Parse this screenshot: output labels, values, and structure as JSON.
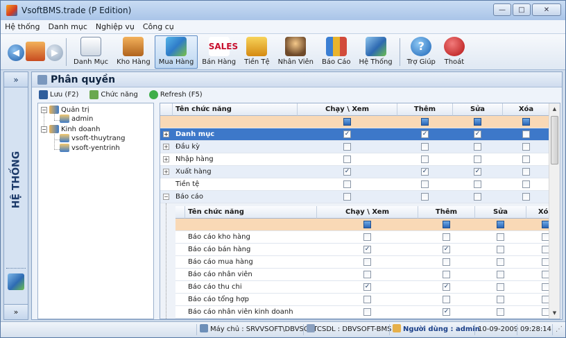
{
  "window": {
    "title": "VsoftBMS.trade (P Edition)",
    "btn_min": "—",
    "btn_max": "□",
    "btn_close": "✕"
  },
  "menu": [
    "Hệ thống",
    "Danh mục",
    "Nghiệp vụ",
    "Công cụ"
  ],
  "toolbar": {
    "back": "◀",
    "forward": "▶",
    "buttons": [
      "Danh Mục",
      "Kho Hàng",
      "Mua Hàng",
      "Bán Hàng",
      "Tiền Tệ",
      "Nhân Viên",
      "Báo Cáo",
      "Hệ Thống",
      "Trợ Giúp",
      "Thoát"
    ],
    "active": "Mua Hàng"
  },
  "leftstrip": {
    "collapse": "»",
    "label": "HỆ THỐNG",
    "expand": "»"
  },
  "panel": {
    "title": "Phân quyền",
    "save": "Lưu (F2)",
    "functions": "Chức năng",
    "refresh": "Refresh (F5)"
  },
  "tree": [
    {
      "label": "Quản trị",
      "level": 0,
      "expander": "−"
    },
    {
      "label": "admin",
      "level": 1
    },
    {
      "label": "Kinh doanh",
      "level": 0,
      "expander": "−"
    },
    {
      "label": "vsoft-thuytrang",
      "level": 1
    },
    {
      "label": "vsoft-yentrinh",
      "level": 1
    }
  ],
  "grid": {
    "columns": [
      "Tên chức năng",
      "Chạy \\ Xem",
      "Thêm",
      "Sửa",
      "Xóa"
    ],
    "rows": [
      {
        "name": "",
        "filter": true
      },
      {
        "name": "Danh mục",
        "expander": "+",
        "checks": [
          true,
          true,
          true,
          false
        ],
        "selected": true
      },
      {
        "name": "Đầu kỳ",
        "expander": "+",
        "checks": [
          false,
          false,
          false,
          false
        ]
      },
      {
        "name": "Nhập hàng",
        "expander": "+",
        "checks": [
          false,
          false,
          false,
          false
        ]
      },
      {
        "name": "Xuất hàng",
        "expander": "+",
        "checks": [
          true,
          true,
          true,
          false
        ]
      },
      {
        "name": "Tiền tệ",
        "checks": [
          false,
          false,
          false,
          false
        ]
      },
      {
        "name": "Báo cáo",
        "expander": "−",
        "checks": [
          false,
          false,
          false,
          false
        ]
      }
    ],
    "sub_columns": [
      "Tên chức năng",
      "Chạy \\ Xem",
      "Thêm",
      "Sửa",
      "Xóa"
    ],
    "sub_rows": [
      {
        "name": "",
        "filter": true
      },
      {
        "name": "Báo cáo kho hàng",
        "checks": [
          false,
          false,
          false,
          false
        ]
      },
      {
        "name": "Báo cáo bán hàng",
        "checks": [
          true,
          true,
          false,
          false
        ]
      },
      {
        "name": "Báo cáo mua hàng",
        "checks": [
          false,
          false,
          false,
          false
        ]
      },
      {
        "name": "Báo cáo nhân viên",
        "checks": [
          false,
          false,
          false,
          false
        ]
      },
      {
        "name": "Báo cáo thu chi",
        "checks": [
          true,
          true,
          false,
          false
        ]
      },
      {
        "name": "Báo cáo tổng hợp",
        "checks": [
          false,
          false,
          false,
          false
        ]
      },
      {
        "name": "Báo cáo nhân viên kinh doanh",
        "checks": [
          false,
          true,
          false,
          false
        ]
      }
    ]
  },
  "status": {
    "server": "Máy chủ : SRVVSOFT\\DBVSOFT",
    "db": "CSDL : DBVSOFT-BMS",
    "user": "Người dùng : admin",
    "date": "10-09-2009",
    "time": "09:28:14"
  }
}
